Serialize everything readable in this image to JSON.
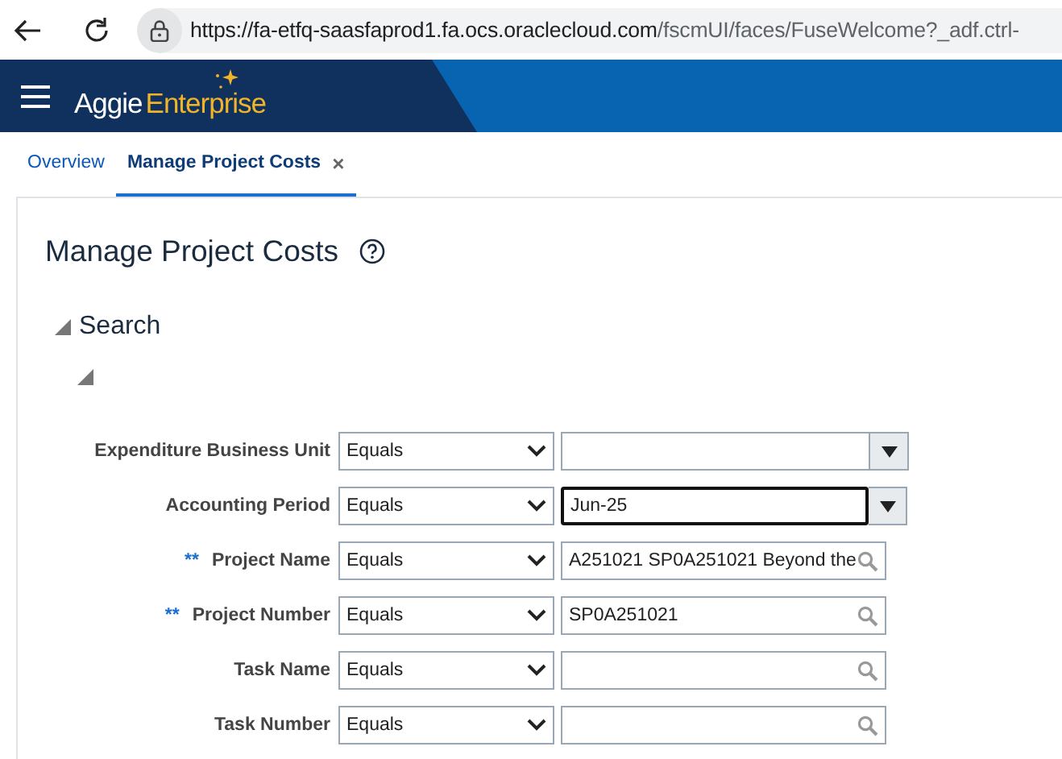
{
  "browser": {
    "url_host": "https://fa-etfq-saasfaprod1.fa.ocs.oraclecloud.com",
    "url_path": "/fscmUI/faces/FuseWelcome?_adf.ctrl-"
  },
  "header": {
    "brand_first": "Aggie",
    "brand_second": "Enterprise"
  },
  "tabs": [
    {
      "label": "Overview",
      "selected": false,
      "closable": false
    },
    {
      "label": "Manage Project Costs",
      "selected": true,
      "closable": true
    }
  ],
  "close_glyph": "×",
  "page": {
    "title": "Manage Project Costs",
    "section": "Search",
    "section_expanded": true,
    "subsection_expanded": true
  },
  "criteria": [
    {
      "label": "Expenditure Business Unit",
      "required": false,
      "operator": "Equals",
      "kind": "choice",
      "focused": false
    },
    {
      "label": "Accounting Period",
      "required": false,
      "operator": "Equals",
      "kind": "choice",
      "value": "Jun-25",
      "focused": true
    },
    {
      "label": "Project Name",
      "required": true,
      "operator": "Equals",
      "kind": "lookup",
      "value": "A251021 SP0A251021 Beyond the",
      "focused": false
    },
    {
      "label": "Project Number",
      "required": true,
      "operator": "Equals",
      "kind": "lookup",
      "value": "SP0A251021",
      "focused": false
    },
    {
      "label": "Task Name",
      "required": false,
      "operator": "Equals",
      "kind": "lookup",
      "focused": false
    },
    {
      "label": "Task Number",
      "required": false,
      "operator": "Equals",
      "kind": "lookup",
      "focused": false
    }
  ],
  "required_mark": "**"
}
